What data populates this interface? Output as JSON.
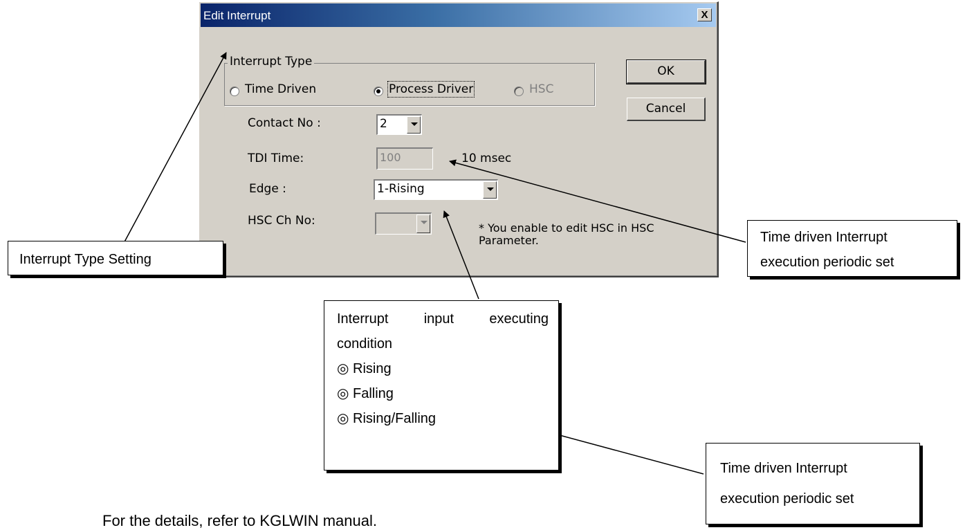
{
  "dialog": {
    "title": "Edit Interrupt",
    "close_label": "X",
    "interrupt_type": {
      "legend": "Interrupt Type",
      "options": [
        {
          "label": "Time Driven",
          "selected": false,
          "enabled": true
        },
        {
          "label": "Process Driver",
          "selected": true,
          "enabled": true
        },
        {
          "label": "HSC",
          "selected": false,
          "enabled": false
        }
      ]
    },
    "ok_label": "OK",
    "cancel_label": "Cancel",
    "contact_no": {
      "label": "Contact No :",
      "value": "2"
    },
    "tdi_time": {
      "label": "TDI Time:",
      "value": "100",
      "unit": "10 msec"
    },
    "edge": {
      "label": "Edge :",
      "value": "1-Rising"
    },
    "hsc_ch_no": {
      "label": "HSC Ch No:",
      "value": ""
    },
    "hsc_note_line1": "* You enable to edit HSC in HSC",
    "hsc_note_line2": "Parameter."
  },
  "callouts": {
    "interrupt_type": "Interrupt Type Setting",
    "time_driven_1": [
      "Time driven Interrupt",
      "execution periodic set"
    ],
    "input_condition": [
      "Interrupt input executing",
      "condition",
      "◎ Rising",
      "◎ Falling",
      "◎ Rising/Falling"
    ],
    "time_driven_2": [
      "Time driven Interrupt",
      "execution periodic set"
    ]
  },
  "footnote": "For the details, refer to KGLWIN manual."
}
